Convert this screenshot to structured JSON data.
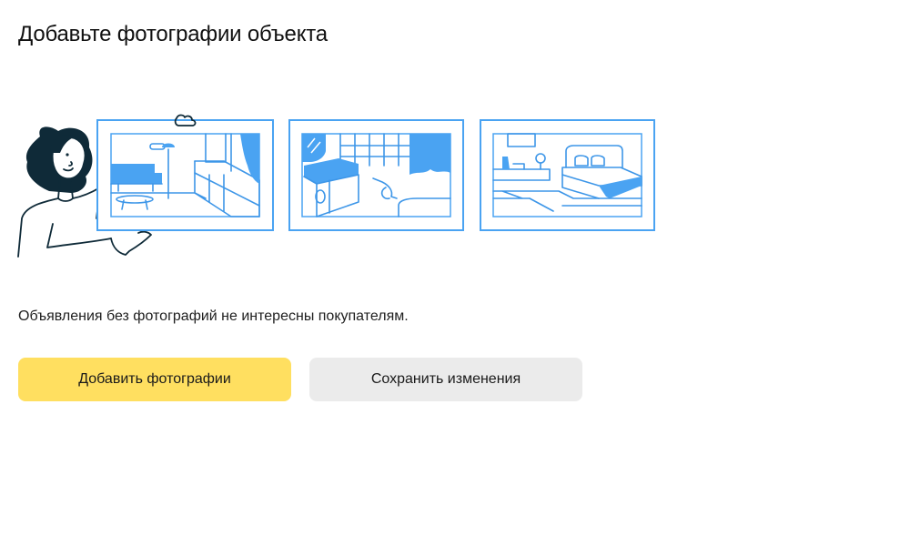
{
  "header": {
    "title": "Добавьте фотографии объекта"
  },
  "main": {
    "description": "Объявления без фотографий не интересны покупателям.",
    "illustration": {
      "icon": "woman-holding-photos-illustration",
      "frames": [
        "living-room-photo-icon",
        "bathroom-photo-icon",
        "bedroom-photo-icon"
      ]
    }
  },
  "actions": {
    "add_photos_label": "Добавить фотографии",
    "save_changes_label": "Сохранить изменения"
  },
  "colors": {
    "primary_button": "#ffdf60",
    "secondary_button": "#ebebeb",
    "illustration_blue": "#4aa3f2",
    "illustration_dark": "#0f2a38"
  }
}
